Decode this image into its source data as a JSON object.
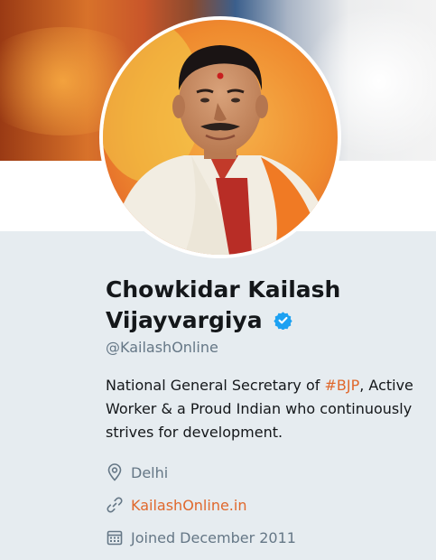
{
  "profile": {
    "name_line1": "Chowkidar Kailash",
    "name_line2": "Vijayvargiya",
    "handle": "@KailashOnline",
    "bio_before": "National General Secretary of ",
    "bio_hashtag": "#BJP",
    "bio_after": ", Active Worker & a Proud Indian who continuously strives for development.",
    "location": "Delhi",
    "website": "KailashOnline.in",
    "joined": "Joined December 2011"
  },
  "icons": {
    "verified": "verified-badge-icon",
    "location": "location-pin-icon",
    "website": "link-icon",
    "joined": "calendar-icon"
  },
  "colors": {
    "link": "#e0682c",
    "verified": "#1da1f2",
    "muted": "#657786",
    "text": "#14171a",
    "panel": "#e6ecf0"
  }
}
